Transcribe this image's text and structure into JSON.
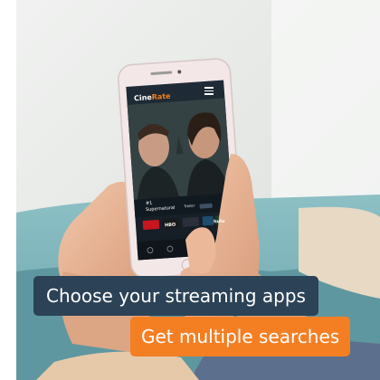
{
  "caption_primary": "Choose your streaming apps",
  "caption_secondary": "Get multiple searches",
  "colors": {
    "caption_primary_bg": "#2c4256",
    "caption_secondary_bg": "#f47f23",
    "brand_accent": "#f47f23"
  },
  "phone_screen": {
    "brand_part1": "Cine",
    "brand_part2": "Rate",
    "menu_icon": "hamburger-menu-icon",
    "show_number": "#1",
    "show_title": "Supernatural",
    "trailer_label": "Trailer",
    "streaming_logos": [
      "HBO",
      "hulu"
    ]
  }
}
